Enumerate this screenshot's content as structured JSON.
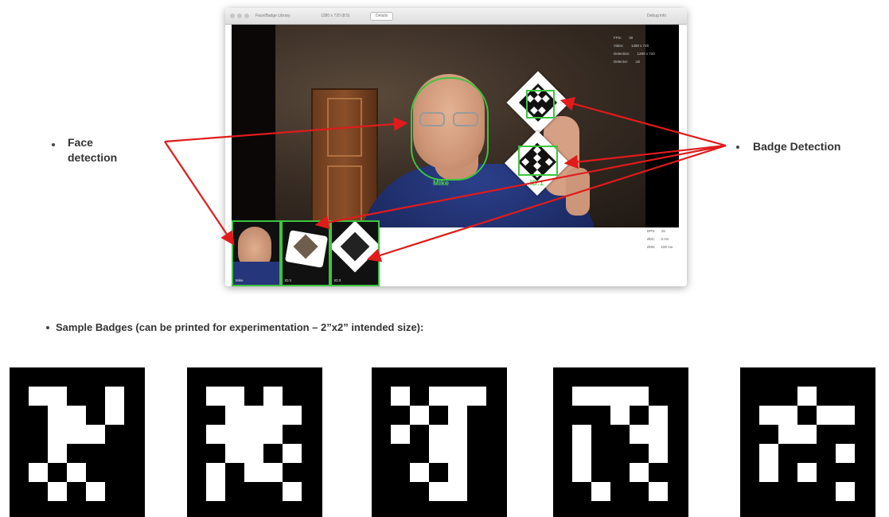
{
  "callouts": {
    "face": "Face\ndetection",
    "badge": "Badge Detection"
  },
  "window": {
    "title": "Face/Badge Library",
    "resolution": "1280 x 720 (8:5)",
    "button": "Details",
    "right_text": "Debug info"
  },
  "stats_top": [
    {
      "k": "FPS:",
      "v": "30"
    },
    {
      "k": "Video:",
      "v": "1280 x 720"
    },
    {
      "k": "Detection:",
      "v": "1280 x 720"
    },
    {
      "k": "Detector:",
      "v": "LB"
    }
  ],
  "detections": {
    "face_label": "Mike",
    "badge_a": "",
    "badge_b": "ID:1"
  },
  "thumbs": [
    {
      "label": "Mike"
    },
    {
      "label": "ID:1"
    },
    {
      "label": "ID:3"
    }
  ],
  "stats_bottom": [
    {
      "k": "DPS:",
      "v": "15"
    },
    {
      "k": "dDC:",
      "v": "0 ms"
    },
    {
      "k": "dNN:",
      "v": "100 ms"
    }
  ],
  "samples": {
    "heading": "Sample Badges (can be printed for experimentation – 2”x2” intended size):"
  },
  "colors": {
    "detect_green": "#3ec43e",
    "arrow_red": "#e11b1b"
  }
}
